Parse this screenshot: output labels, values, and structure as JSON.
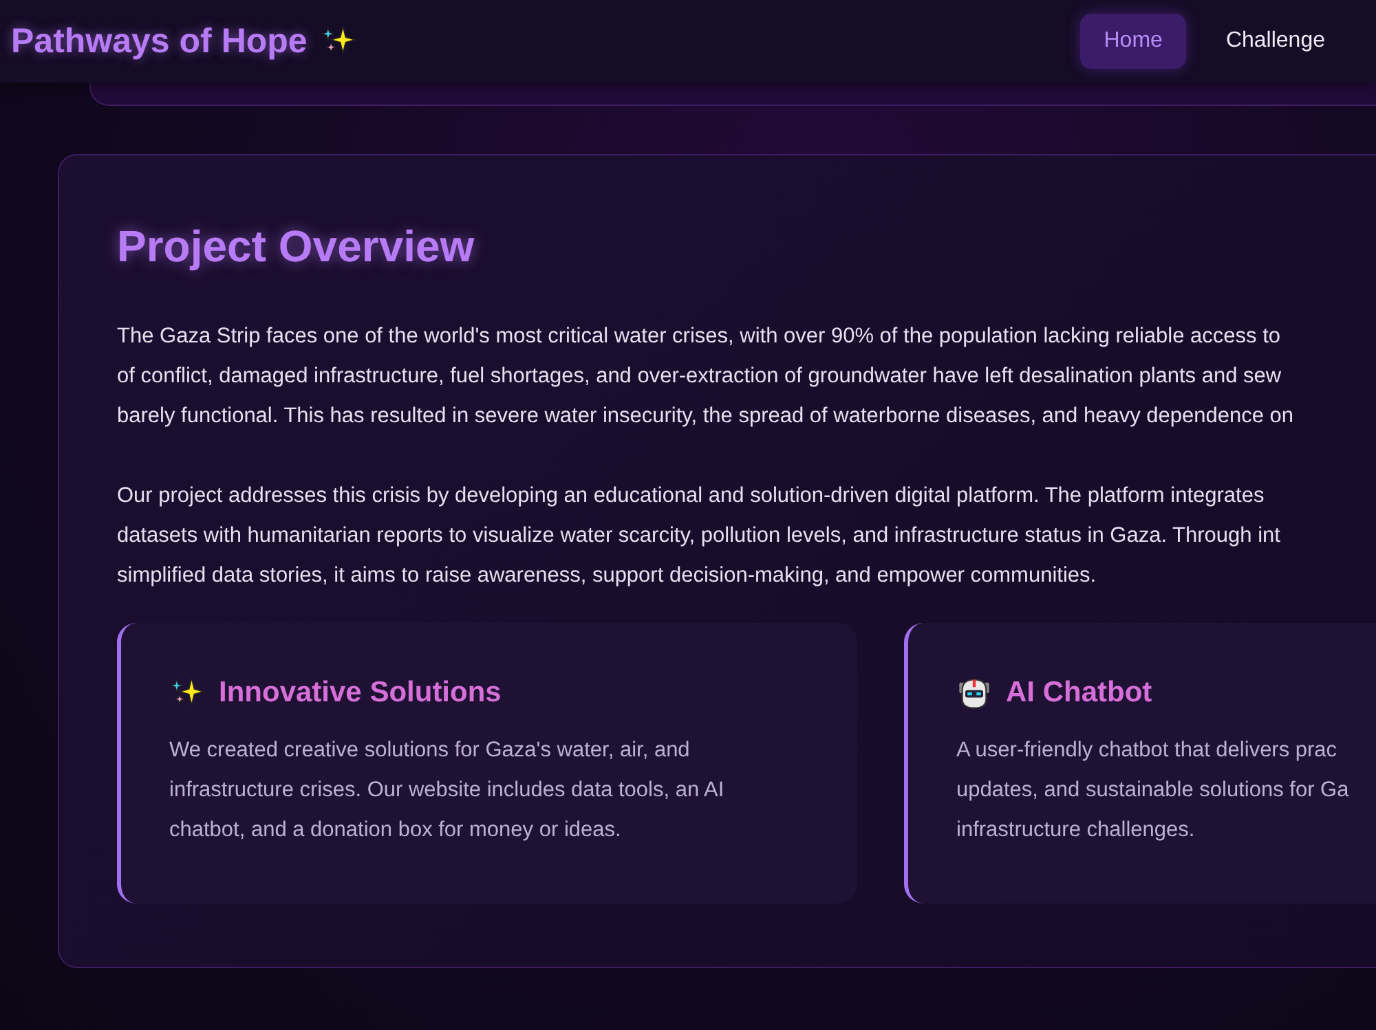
{
  "header": {
    "title": "Pathways of Hope",
    "nav": [
      {
        "label": "Home",
        "selected": true
      },
      {
        "label": "Challenge",
        "selected": false
      }
    ]
  },
  "overview": {
    "title": "Project Overview",
    "paragraphs": [
      [
        "The Gaza Strip faces one of the world's most critical water crises, with over 90% of the population lacking reliable access to",
        "of conflict, damaged infrastructure, fuel shortages, and over-extraction of groundwater have left desalination plants and sew",
        "barely functional. This has resulted in severe water insecurity, the spread of waterborne diseases, and heavy dependence on"
      ],
      [
        "Our project addresses this crisis by developing an educational and solution-driven digital platform. The platform integrates",
        "datasets with humanitarian reports to visualize water scarcity, pollution levels, and infrastructure status in Gaza. Through int",
        "simplified data stories, it aims to raise awareness, support decision-making, and empower communities."
      ]
    ],
    "features": [
      {
        "kind": "sparkles",
        "title": "Innovative Solutions",
        "lines": [
          "We created creative solutions for Gaza's water, air, and",
          "infrastructure crises. Our website includes data tools, an AI",
          "chatbot, and a donation box for money or ideas."
        ]
      },
      {
        "kind": "robot",
        "title": "AI Chatbot",
        "lines": [
          "A user-friendly chatbot that delivers prac",
          "updates, and sustainable solutions for Ga",
          "infrastructure challenges."
        ]
      }
    ]
  }
}
